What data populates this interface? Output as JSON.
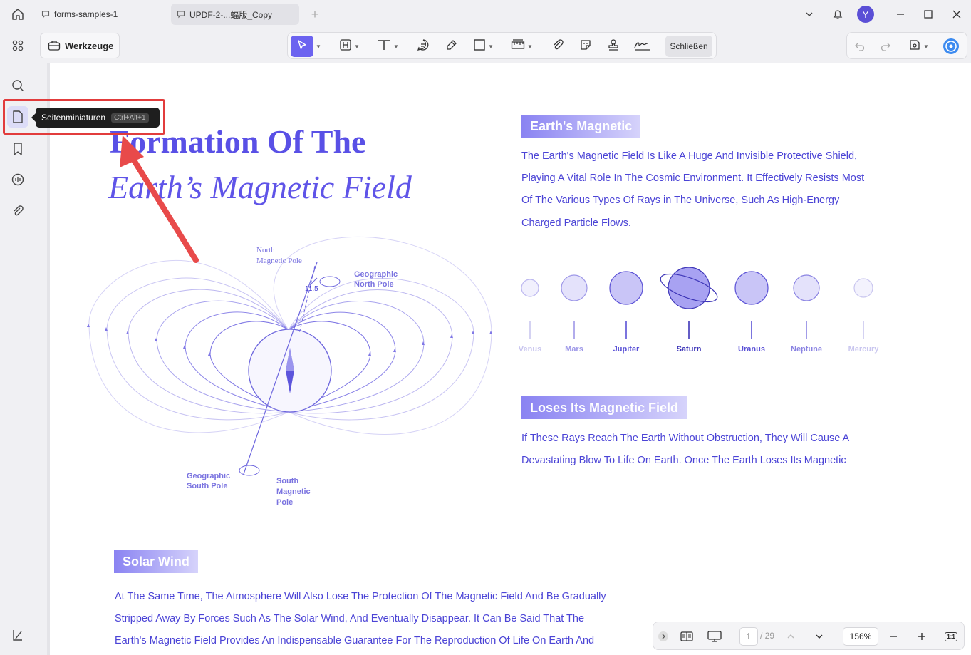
{
  "tabs": [
    {
      "label": "forms-samples-1"
    },
    {
      "label": "UPDF-2-...蝠版_Copy"
    }
  ],
  "user": {
    "avatar_initial": "Y"
  },
  "toolbar": {
    "tools_label": "Werkzeuge",
    "close_label": "Schließen"
  },
  "tooltip": {
    "label": "Seitenminiaturen",
    "shortcut": "Ctrl+Alt+1"
  },
  "document": {
    "title_line1": "Formation Of The",
    "title_line2": "Earth’s Magnetic Field",
    "section1": {
      "heading": "Earth's Magnetic",
      "lines": [
        "The Earth's Magnetic Field Is Like A Huge And Invisible Protective Shield,",
        "Playing A Vital Role In The Cosmic Environment. It Effectively Resists Most",
        "Of The Various Types Of Rays in The Universe, Such As High-Energy",
        "Charged Particle Flows."
      ]
    },
    "planets": [
      {
        "name": "Venus",
        "color": "#c9c6ef"
      },
      {
        "name": "Mars",
        "color": "#9e98e8"
      },
      {
        "name": "Jupiter",
        "color": "#5a51d6"
      },
      {
        "name": "Saturn",
        "color": "#3d35b8"
      },
      {
        "name": "Uranus",
        "color": "#5a51d6"
      },
      {
        "name": "Neptune",
        "color": "#8a83e2"
      },
      {
        "name": "Mercury",
        "color": "#c9c6ef"
      }
    ],
    "section2": {
      "heading": "Loses Its Magnetic Field",
      "lines": [
        "If These Rays Reach The Earth Without Obstruction, They Will Cause A",
        "Devastating Blow To Life On Earth. Once The Earth Loses Its Magnetic"
      ]
    },
    "section3": {
      "heading": "Solar Wind",
      "lines": [
        "At The Same Time, The Atmosphere Will Also Lose The Protection Of The Magnetic Field And Be Gradually",
        "Stripped Away By Forces Such As The Solar Wind, And Eventually Disappear. It Can Be Said That The",
        "Earth's Magnetic Field Provides An Indispensable Guarantee For The Reproduction Of Life On Earth And"
      ]
    },
    "diagram": {
      "north_magnetic_pole": [
        "North",
        "Magnetic Pole"
      ],
      "geographic_north_pole": [
        "Geographic",
        "North Pole"
      ],
      "geographic_south_pole": [
        "Geographic",
        "South Pole"
      ],
      "south_magnetic_pole": [
        "South",
        "Magnetic",
        "Pole"
      ],
      "angle_label": "11.5"
    }
  },
  "navigation": {
    "current_page": "1",
    "total_pages": "/ 29",
    "zoom": "156%",
    "fit_label": "1:1"
  },
  "colors": {
    "accent": "#6c63f0",
    "text_purple": "#4b44d6",
    "annotation_red": "#e23c3c"
  }
}
